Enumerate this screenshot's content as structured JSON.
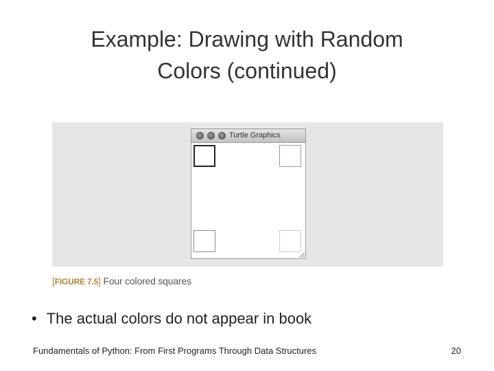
{
  "slide": {
    "title_line1": "Example: Drawing with Random",
    "title_line2": "Colors (continued)",
    "bullet": "The actual colors do not appear in book",
    "footer": "Fundamentals of Python: From First Programs Through Data Structures",
    "page_number": "20"
  },
  "figure": {
    "window_title": "Turtle Graphics",
    "caption_label": "FIGURE 7.5",
    "caption_text": "Four colored squares",
    "squares": [
      {
        "position": "top-left",
        "border_color": "#222222"
      },
      {
        "position": "top-right",
        "border_color": "#9a9a9a"
      },
      {
        "position": "bottom-left",
        "border_color": "#8a8a8a"
      },
      {
        "position": "bottom-right",
        "border_color": "#cfcfcf"
      }
    ]
  }
}
